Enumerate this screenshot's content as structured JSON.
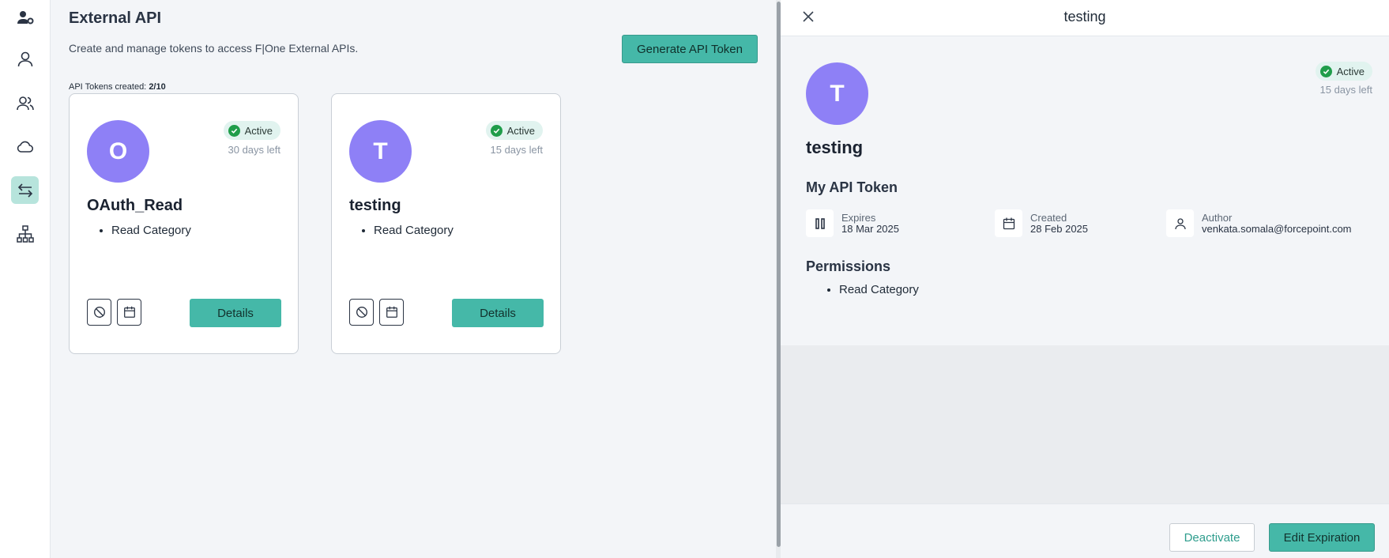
{
  "nav": {
    "items": [
      {
        "icon": "user-gear-icon"
      },
      {
        "icon": "user-icon"
      },
      {
        "icon": "users-icon"
      },
      {
        "icon": "cloud-icon"
      },
      {
        "icon": "arrows-exchange-icon",
        "active": true
      },
      {
        "icon": "sitemap-icon"
      }
    ]
  },
  "main": {
    "title": "External API",
    "subtitle": "Create and manage tokens to access F|One External APIs.",
    "generate_label": "Generate API Token",
    "tokens_label": "API Tokens created: ",
    "tokens_count": "2/10",
    "cards": [
      {
        "initial": "O",
        "status": "Active",
        "days_left": "30 days left",
        "name": "OAuth_Read",
        "permissions": [
          "Read Category"
        ],
        "details_label": "Details"
      },
      {
        "initial": "T",
        "status": "Active",
        "days_left": "15 days left",
        "name": "testing",
        "permissions": [
          "Read Category"
        ],
        "details_label": "Details"
      }
    ]
  },
  "panel": {
    "title": "testing",
    "initial": "T",
    "status": "Active",
    "days_left": "15 days left",
    "name": "testing",
    "section_title": "My API Token",
    "expires_label": "Expires",
    "expires_value": "18 Mar 2025",
    "created_label": "Created",
    "created_value": "28 Feb 2025",
    "author_label": "Author",
    "author_value": "venkata.somala@forcepoint.com",
    "permissions_title": "Permissions",
    "permissions": [
      "Read Category"
    ],
    "deactivate_label": "Deactivate",
    "edit_label": "Edit Expiration"
  },
  "colors": {
    "accent": "#45b8a8",
    "avatar": "#8e80f6",
    "active_badge_bg": "#e1f3ef",
    "active_check": "#1f9d4a"
  }
}
